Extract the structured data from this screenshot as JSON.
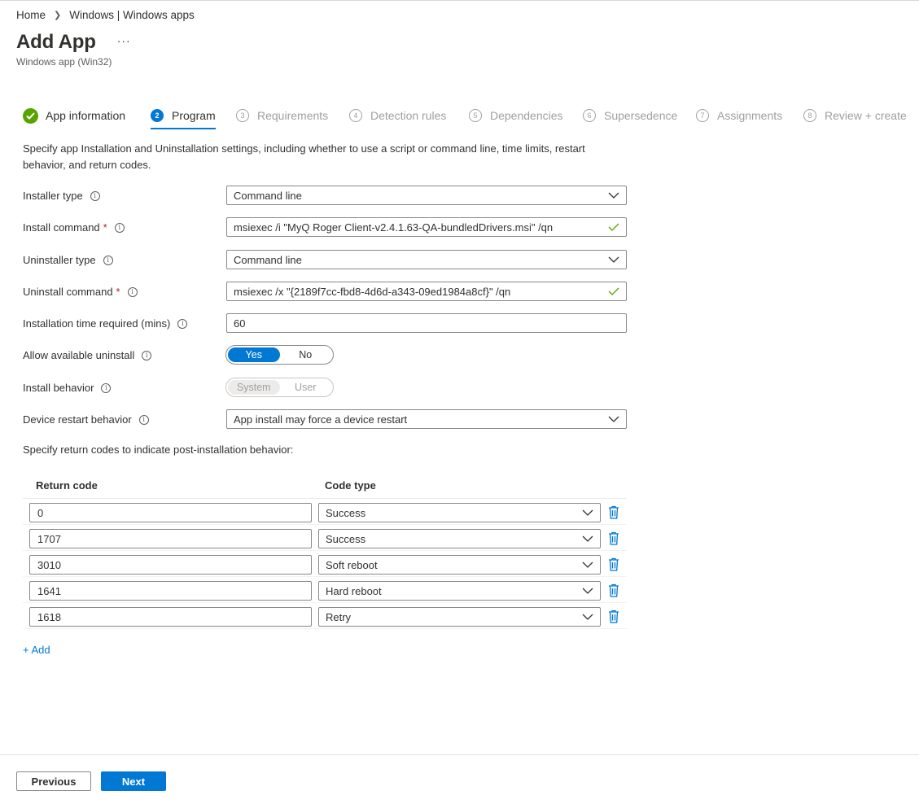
{
  "breadcrumb": {
    "home": "Home",
    "current": "Windows | Windows apps"
  },
  "header": {
    "title": "Add App",
    "more": "···",
    "subtitle": "Windows app (Win32)"
  },
  "steps": [
    {
      "num": "",
      "label": "App information",
      "state": "done"
    },
    {
      "num": "2",
      "label": "Program",
      "state": "active"
    },
    {
      "num": "3",
      "label": "Requirements",
      "state": "pending"
    },
    {
      "num": "4",
      "label": "Detection rules",
      "state": "pending"
    },
    {
      "num": "5",
      "label": "Dependencies",
      "state": "pending"
    },
    {
      "num": "6",
      "label": "Supersedence",
      "state": "pending"
    },
    {
      "num": "7",
      "label": "Assignments",
      "state": "pending"
    },
    {
      "num": "8",
      "label": "Review + create",
      "state": "pending"
    }
  ],
  "description": "Specify app Installation and Uninstallation settings, including whether to use a script or command line, time limits, restart behavior, and return codes.",
  "form": {
    "installer_type": {
      "label": "Installer type",
      "value": "Command line"
    },
    "install_command": {
      "label": "Install command",
      "required": "*",
      "value": "msiexec /i \"MyQ Roger Client-v2.4.1.63-QA-bundledDrivers.msi\" /qn"
    },
    "uninstaller_type": {
      "label": "Uninstaller type",
      "value": "Command line"
    },
    "uninstall_command": {
      "label": "Uninstall command",
      "required": "*",
      "value": "msiexec /x \"{2189f7cc-fbd8-4d6d-a343-09ed1984a8cf}\" /qn"
    },
    "install_time": {
      "label": "Installation time required (mins)",
      "value": "60"
    },
    "allow_uninstall": {
      "label": "Allow available uninstall",
      "options": [
        "Yes",
        "No"
      ],
      "selected": "Yes"
    },
    "install_behavior": {
      "label": "Install behavior",
      "options": [
        "System",
        "User"
      ],
      "selected": "System"
    },
    "restart_behavior": {
      "label": "Device restart behavior",
      "value": "App install may force a device restart"
    }
  },
  "return_codes": {
    "intro": "Specify return codes to indicate post-installation behavior:",
    "headers": {
      "code": "Return code",
      "type": "Code type"
    },
    "rows": [
      {
        "code": "0",
        "type": "Success"
      },
      {
        "code": "1707",
        "type": "Success"
      },
      {
        "code": "3010",
        "type": "Soft reboot"
      },
      {
        "code": "1641",
        "type": "Hard reboot"
      },
      {
        "code": "1618",
        "type": "Retry"
      }
    ],
    "add_label": "+ Add"
  },
  "footer": {
    "previous": "Previous",
    "next": "Next"
  },
  "colors": {
    "accent": "#0078d4",
    "success": "#57a300",
    "required": "#a4262c"
  }
}
